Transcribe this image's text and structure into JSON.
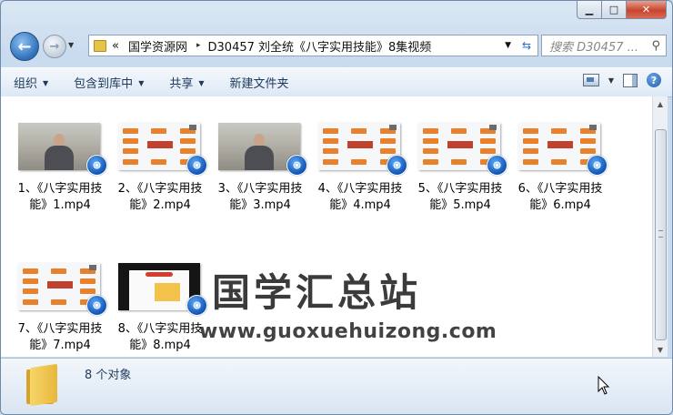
{
  "window": {
    "caption": {
      "minimize": "▁",
      "maximize": "□",
      "close": "✕"
    }
  },
  "nav": {
    "back": "←",
    "forward": "→",
    "breadcrumb_chevrons": "«",
    "path": [
      "国学资源网",
      "D30457 刘全统《八字实用技能》8集视频"
    ],
    "separator": "▸",
    "refresh": "⇆",
    "search_placeholder": "搜索 D30457 ..."
  },
  "toolbar": {
    "organize": "组织",
    "include_library": "包含到库中",
    "share": "共享",
    "new_folder": "新建文件夹"
  },
  "files": [
    {
      "line1": "1、《八字实用技",
      "line2": "能》1.mp4",
      "thumb": "person"
    },
    {
      "line1": "2、《八字实用技",
      "line2": "能》2.mp4",
      "thumb": "slide"
    },
    {
      "line1": "3、《八字实用技",
      "line2": "能》3.mp4",
      "thumb": "person"
    },
    {
      "line1": "4、《八字实用技",
      "line2": "能》4.mp4",
      "thumb": "slide"
    },
    {
      "line1": "5、《八字实用技",
      "line2": "能》5.mp4",
      "thumb": "slide"
    },
    {
      "line1": "6、《八字实用技",
      "line2": "能》6.mp4",
      "thumb": "slide"
    },
    {
      "line1": "7、《八字实用技",
      "line2": "能》7.mp4",
      "thumb": "slide"
    },
    {
      "line1": "8、《八字实用技",
      "line2": "能》8.mp4",
      "thumb": "dark"
    }
  ],
  "watermark": {
    "title": "国学汇总站",
    "url": "www.guoxuehuizong.com"
  },
  "details": {
    "count": "8 个对象"
  },
  "colors": {
    "frame": "#c9dbee",
    "badge": "#1254b5",
    "close": "#c8452e"
  }
}
